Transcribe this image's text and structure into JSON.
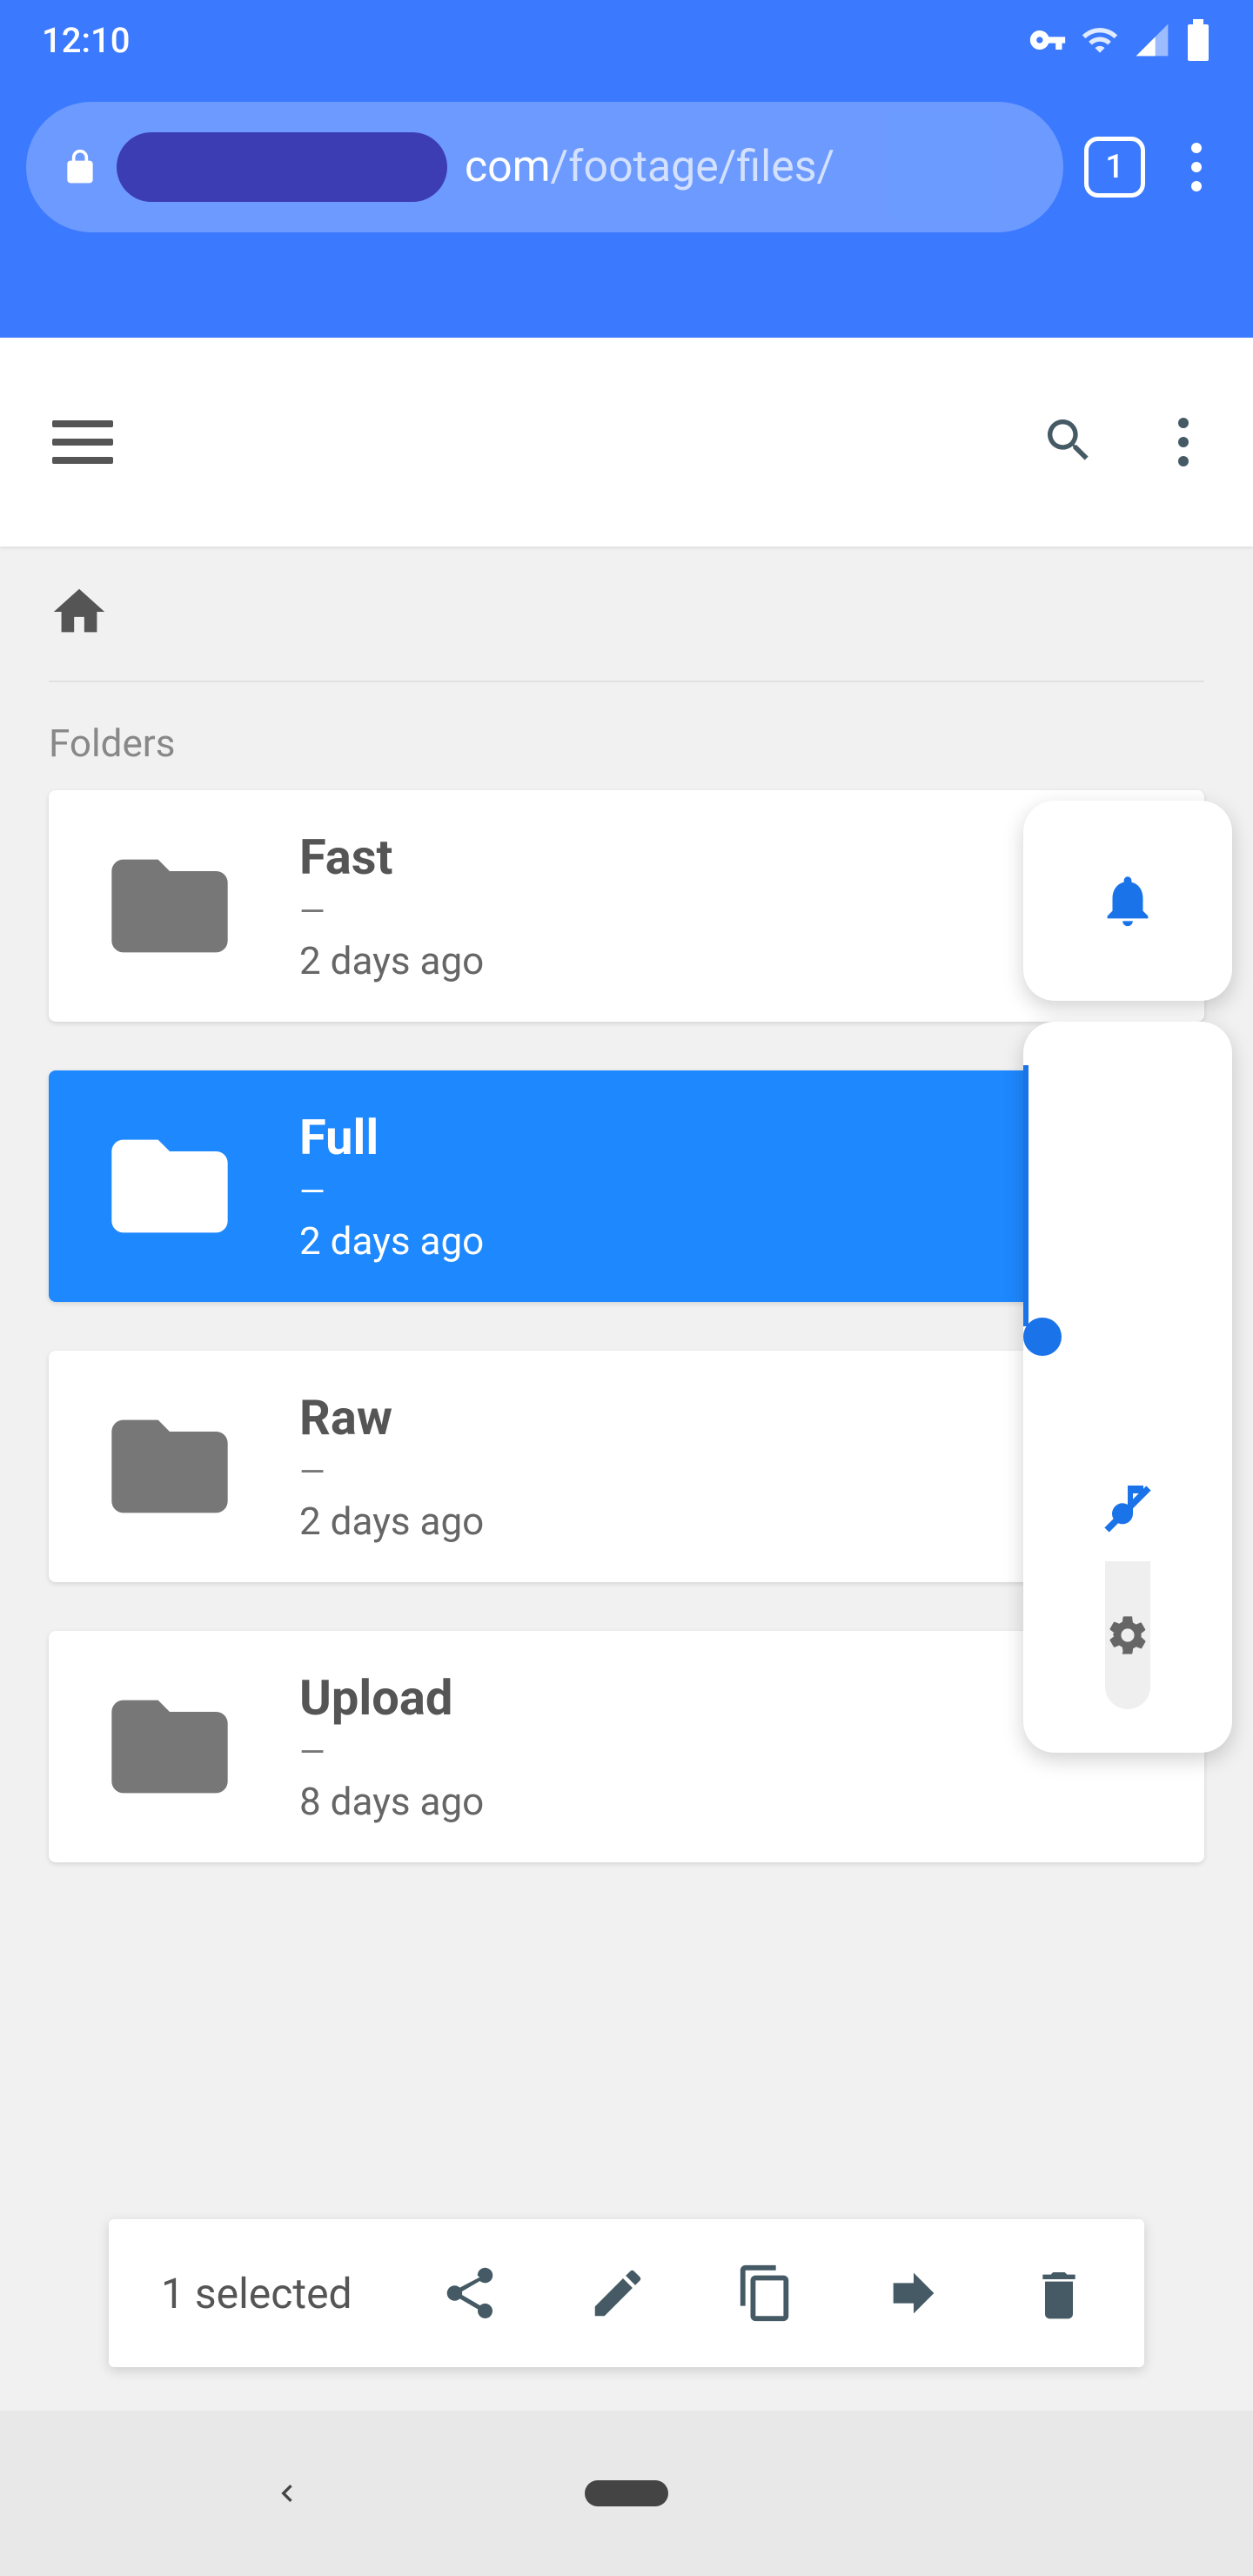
{
  "status": {
    "time": "12:10"
  },
  "browser": {
    "url_domain_suffix": "com",
    "url_path": "/footage/files/",
    "tab_count": "1"
  },
  "section_label": "Folders",
  "folders": [
    {
      "name": "Fast",
      "size": "—",
      "date": "2 days ago",
      "selected": false
    },
    {
      "name": "Full",
      "size": "—",
      "date": "2 days ago",
      "selected": true
    },
    {
      "name": "Raw",
      "size": "—",
      "date": "2 days ago",
      "selected": false
    },
    {
      "name": "Upload",
      "size": "—",
      "date": "8 days ago",
      "selected": false
    }
  ],
  "selection_bar": {
    "label": "1 selected"
  }
}
